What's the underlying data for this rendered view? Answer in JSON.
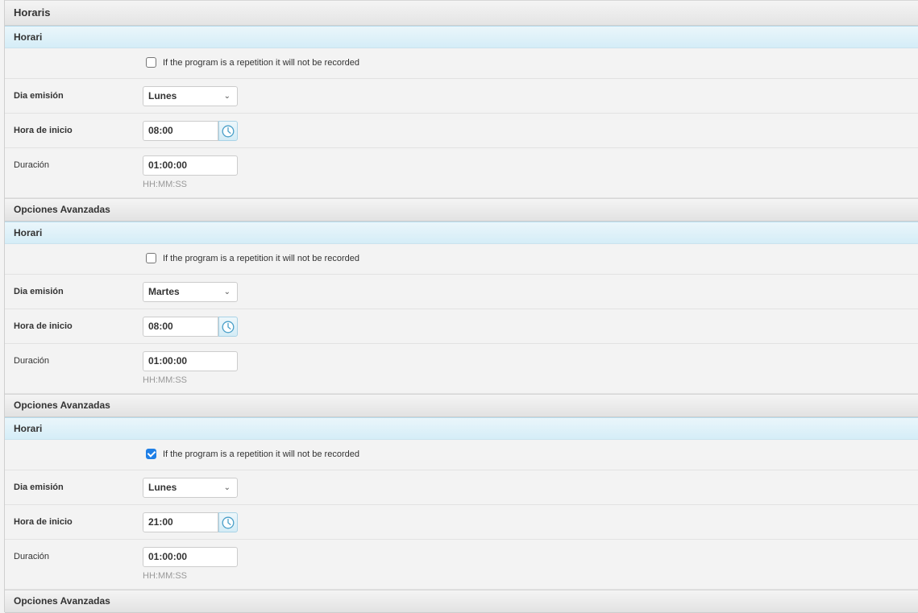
{
  "main_title": "Horaris",
  "blocks": [
    {
      "section_title": "Horari",
      "repetition_checked": false,
      "repetition_label": "If the program is a repetition it will not be recorded",
      "day_label": "Dia emisión",
      "day_value": "Lunes",
      "start_label": "Hora de inicio",
      "start_value": "08:00",
      "duration_label": "Duración",
      "duration_value": "01:00:00",
      "duration_hint": "HH:MM:SS",
      "advanced_title": "Opciones Avanzadas"
    },
    {
      "section_title": "Horari",
      "repetition_checked": false,
      "repetition_label": "If the program is a repetition it will not be recorded",
      "day_label": "Dia emisión",
      "day_value": "Martes",
      "start_label": "Hora de inicio",
      "start_value": "08:00",
      "duration_label": "Duración",
      "duration_value": "01:00:00",
      "duration_hint": "HH:MM:SS",
      "advanced_title": "Opciones Avanzadas"
    },
    {
      "section_title": "Horari",
      "repetition_checked": true,
      "repetition_label": "If the program is a repetition it will not be recorded",
      "day_label": "Dia emisión",
      "day_value": "Lunes",
      "start_label": "Hora de inicio",
      "start_value": "21:00",
      "duration_label": "Duración",
      "duration_value": "01:00:00",
      "duration_hint": "HH:MM:SS",
      "advanced_title": "Opciones Avanzadas"
    }
  ],
  "icons": {
    "select_chevron": "chevron-down-icon",
    "clock": "clock-icon"
  },
  "colors": {
    "checkbox_checked": "#1f7fe6",
    "section_header": "#d5edf7",
    "clock_icon": "#4a9fc8"
  }
}
